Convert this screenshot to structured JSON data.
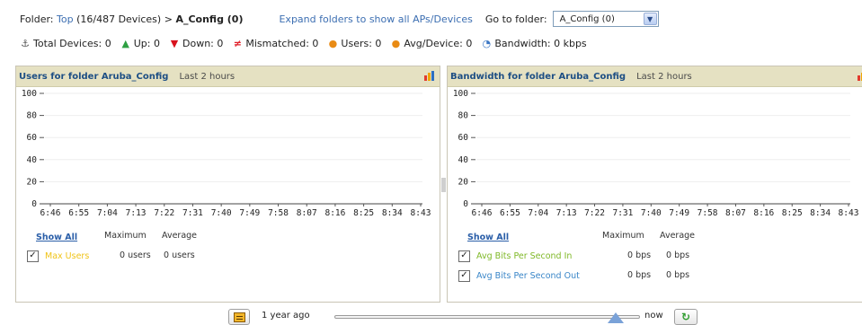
{
  "header": {
    "folder_label": "Folder:",
    "top_link": "Top",
    "top_count": "(16/487 Devices)",
    "separator": ">",
    "current_folder": "A_Config (0)",
    "expand_link": "Expand folders to show all APs/Devices",
    "goto_label": "Go to folder:",
    "goto_value": "A_Config (0)"
  },
  "stats": [
    {
      "icon": "device-icon",
      "label": "Total Devices: 0"
    },
    {
      "icon": "up-arrow-icon",
      "label": "Up: 0"
    },
    {
      "icon": "down-arrow-icon",
      "label": "Down: 0"
    },
    {
      "icon": "mismatch-icon",
      "label": "Mismatched: 0"
    },
    {
      "icon": "user-icon",
      "label": "Users: 0"
    },
    {
      "icon": "user-icon",
      "label": "Avg/Device: 0"
    },
    {
      "icon": "bandwidth-icon",
      "label": "Bandwidth: 0 kbps"
    }
  ],
  "users_panel": {
    "title": "Users for folder Aruba_Config",
    "range": "Last 2 hours",
    "show_all": "Show All",
    "col_max": "Maximum",
    "col_avg": "Average",
    "series": [
      {
        "name": "Max Users",
        "max": "0 users",
        "avg": "0 users",
        "color": "#f0c419",
        "checked": true
      }
    ]
  },
  "bandwidth_panel": {
    "title": "Bandwidth for folder Aruba_Config",
    "range": "Last 2 hours",
    "show_all": "Show All",
    "col_max": "Maximum",
    "col_avg": "Average",
    "series": [
      {
        "name": "Avg Bits Per Second In",
        "max": "0 bps",
        "avg": "0 bps",
        "color": "#7fb827",
        "checked": true
      },
      {
        "name": "Avg Bits Per Second Out",
        "max": "0 bps",
        "avg": "0 bps",
        "color": "#3a86c8",
        "checked": true
      }
    ]
  },
  "timeline": {
    "start_label": "1 year ago",
    "end_label": "now",
    "position": 0.92
  },
  "chart_data": [
    {
      "type": "line",
      "title": "Users for folder Aruba_Config",
      "x": [
        "6:46",
        "6:55",
        "7:04",
        "7:13",
        "7:22",
        "7:31",
        "7:40",
        "7:49",
        "7:58",
        "8:07",
        "8:16",
        "8:25",
        "8:34",
        "8:43"
      ],
      "yticks": [
        0,
        20,
        40,
        60,
        80,
        100
      ],
      "ylim": [
        0,
        100
      ],
      "series": [
        {
          "name": "Max Users",
          "values": []
        }
      ],
      "grid": true
    },
    {
      "type": "line",
      "title": "Bandwidth for folder Aruba_Config",
      "x": [
        "6:46",
        "6:55",
        "7:04",
        "7:13",
        "7:22",
        "7:31",
        "7:40",
        "7:49",
        "7:58",
        "8:07",
        "8:16",
        "8:25",
        "8:34",
        "8:43"
      ],
      "yticks": [
        0,
        20,
        40,
        60,
        80,
        100
      ],
      "ylim": [
        0,
        100
      ],
      "series": [
        {
          "name": "Avg Bits Per Second In",
          "values": []
        },
        {
          "name": "Avg Bits Per Second Out",
          "values": []
        }
      ],
      "grid": true
    }
  ]
}
